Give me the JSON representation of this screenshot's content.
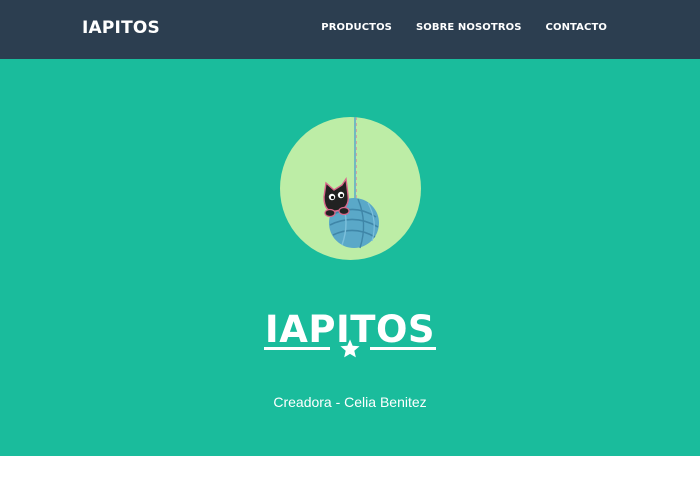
{
  "navbar": {
    "brand": "IAPITOS",
    "links": [
      {
        "label": "PRODUCTOS"
      },
      {
        "label": "SOBRE NOSOTROS"
      },
      {
        "label": "CONTACTO"
      }
    ]
  },
  "masthead": {
    "avatar_icon": "cat-with-yarn-ball-image",
    "title": "IAPITOS",
    "divider_icon": "star-icon",
    "subtitle": "Creadora - Celia Benitez"
  },
  "colors": {
    "navbar_bg": "#2c3e50",
    "masthead_bg": "#1abc9c",
    "avatar_bg": "#bdeda6",
    "text": "#ffffff",
    "yarn": "#5aa8c8"
  }
}
